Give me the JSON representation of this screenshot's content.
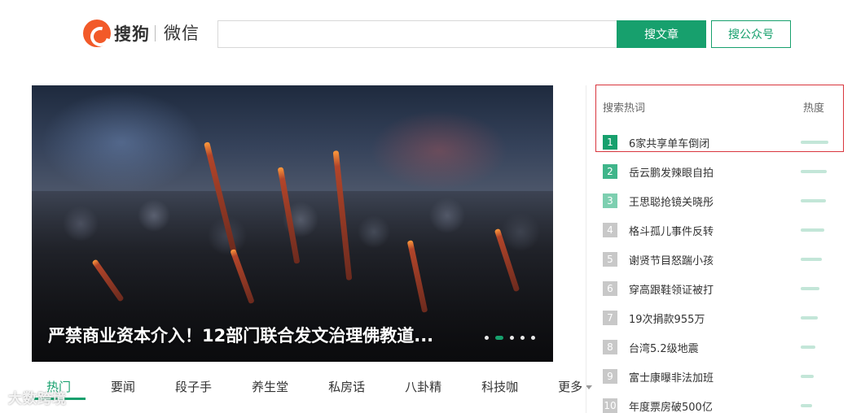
{
  "header": {
    "logo_text": "搜狗",
    "logo_sub": "微信",
    "search_value": "",
    "search_article_label": "搜文章",
    "search_account_label": "搜公众号"
  },
  "hero": {
    "title": "严禁商业资本介入！12部门联合发文治理佛教道...",
    "slides_total": 5,
    "active_slide": 2
  },
  "tabs": [
    {
      "label": "热门",
      "active": true
    },
    {
      "label": "要闻"
    },
    {
      "label": "段子手"
    },
    {
      "label": "养生堂"
    },
    {
      "label": "私房话"
    },
    {
      "label": "八卦精"
    },
    {
      "label": "科技咖"
    },
    {
      "label": "更多"
    }
  ],
  "hot": {
    "title": "搜索热词",
    "heat_label": "热度",
    "items": [
      {
        "rank": "1",
        "text": "6家共享单车倒闭",
        "heat": 0.95
      },
      {
        "rank": "2",
        "text": "岳云鹏发辣眼自拍",
        "heat": 0.9
      },
      {
        "rank": "3",
        "text": "王思聪抢镜关晓彤",
        "heat": 0.85
      },
      {
        "rank": "4",
        "text": "格斗孤儿事件反转",
        "heat": 0.8
      },
      {
        "rank": "5",
        "text": "谢贤节目怒踹小孩",
        "heat": 0.72
      },
      {
        "rank": "6",
        "text": "穿高跟鞋领证被打",
        "heat": 0.65
      },
      {
        "rank": "7",
        "text": "19次捐款955万",
        "heat": 0.58
      },
      {
        "rank": "8",
        "text": "台湾5.2级地震",
        "heat": 0.5
      },
      {
        "rank": "9",
        "text": "富士康曝非法加班",
        "heat": 0.44
      },
      {
        "rank": "10",
        "text": "年度票房破500亿",
        "heat": 0.38
      }
    ]
  },
  "watermark": "大数跨境",
  "colors": {
    "accent": "#17a06d",
    "logo": "#f25a29",
    "highlight": "#d9363e"
  }
}
